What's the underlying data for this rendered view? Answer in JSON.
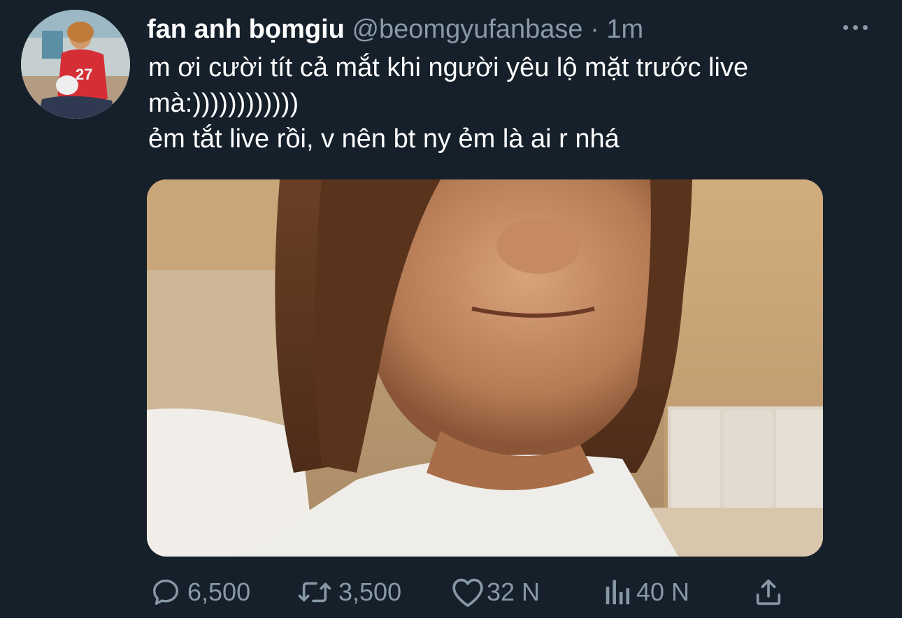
{
  "tweet": {
    "display_name": "fan anh bọmgiu",
    "handle": "@beomgyufanbase",
    "separator": "·",
    "time": "1m",
    "text_lines": [
      "m ơi cười tít cả mắt khi người yêu lộ mặt trước live",
      "mà:))))))))))))",
      "ẻm tắt live rồi, v nên bt ny ẻm là ai r nhá"
    ],
    "media_alt": "photo"
  },
  "actions": {
    "reply_count": "6,500",
    "retweet_count": "3,500",
    "like_count": "32 N",
    "views_count": "40 N"
  },
  "icons": {
    "more": "more-horizontal-icon",
    "reply": "reply-icon",
    "retweet": "retweet-icon",
    "like": "heart-icon",
    "views": "views-bar-icon",
    "share": "share-icon"
  },
  "colors": {
    "background": "#15202b",
    "text": "#ffffff",
    "secondary": "#8899a6"
  }
}
